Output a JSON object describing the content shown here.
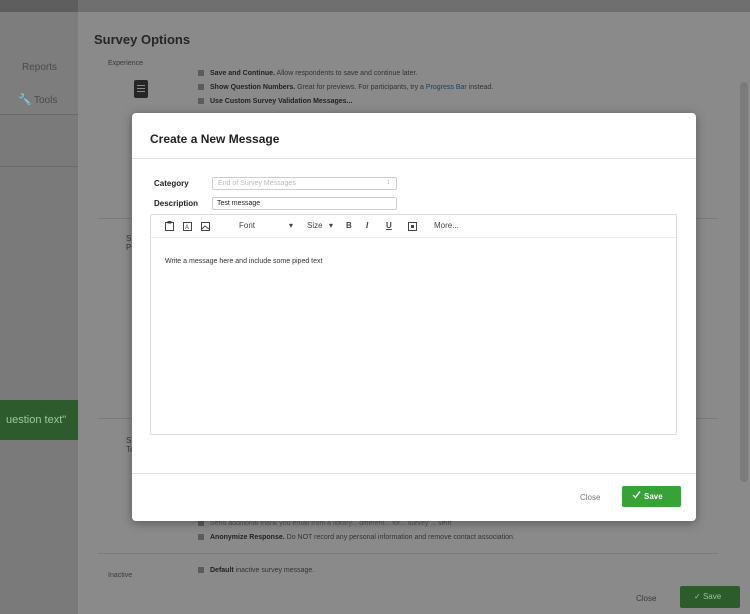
{
  "app": {
    "reports_label": "Reports",
    "tools_label": "Tools",
    "green_banner_text": "uestion text\""
  },
  "survey_options": {
    "title": "Survey Options",
    "experience_label": "Experience",
    "options": [
      {
        "bold": "Save and Continue.",
        "text": " Allow respondents to save and continue later.",
        "link": "",
        "after": ""
      },
      {
        "bold": "Show Question Numbers.",
        "text": " Great for previews. For participants, try a ",
        "link": "Progress Bar",
        "after": " instead."
      },
      {
        "bold": "Use Custom Survey Validation Messages...",
        "text": "",
        "link": "",
        "after": ""
      }
    ],
    "side_label_1_a": "S",
    "side_label_1_b": "Pr",
    "side_label_2_a": "S",
    "side_label_2_b": "Ter",
    "bottom_option_partial": "Send additional thank you email from a library... different... for... survey ... sent",
    "anonymize_bold": "Anonymize Response.",
    "anonymize_text": " Do NOT record any personal information and remove contact association.",
    "inactive_label": "Inactive",
    "inactive_bold": "Default",
    "inactive_text": " inactive survey message.",
    "footer_close": "Close",
    "footer_save": "Save"
  },
  "modal": {
    "title": "Create a New Message",
    "category_label": "Category",
    "category_value": "End of Survey Messages",
    "description_label": "Description",
    "description_value": "Test message",
    "toolbar": {
      "font_label": "Font",
      "size_label": "Size",
      "bold_label": "B",
      "italic_label": "I",
      "underline_label": "U",
      "more_label": "More..."
    },
    "editor_text": "Write a message here and include some piped text",
    "close_label": "Close",
    "save_label": "Save"
  },
  "colors": {
    "save_green": "#37a337",
    "link_blue": "#1e3e6a",
    "overlay_gray": "#8a8a8a"
  }
}
